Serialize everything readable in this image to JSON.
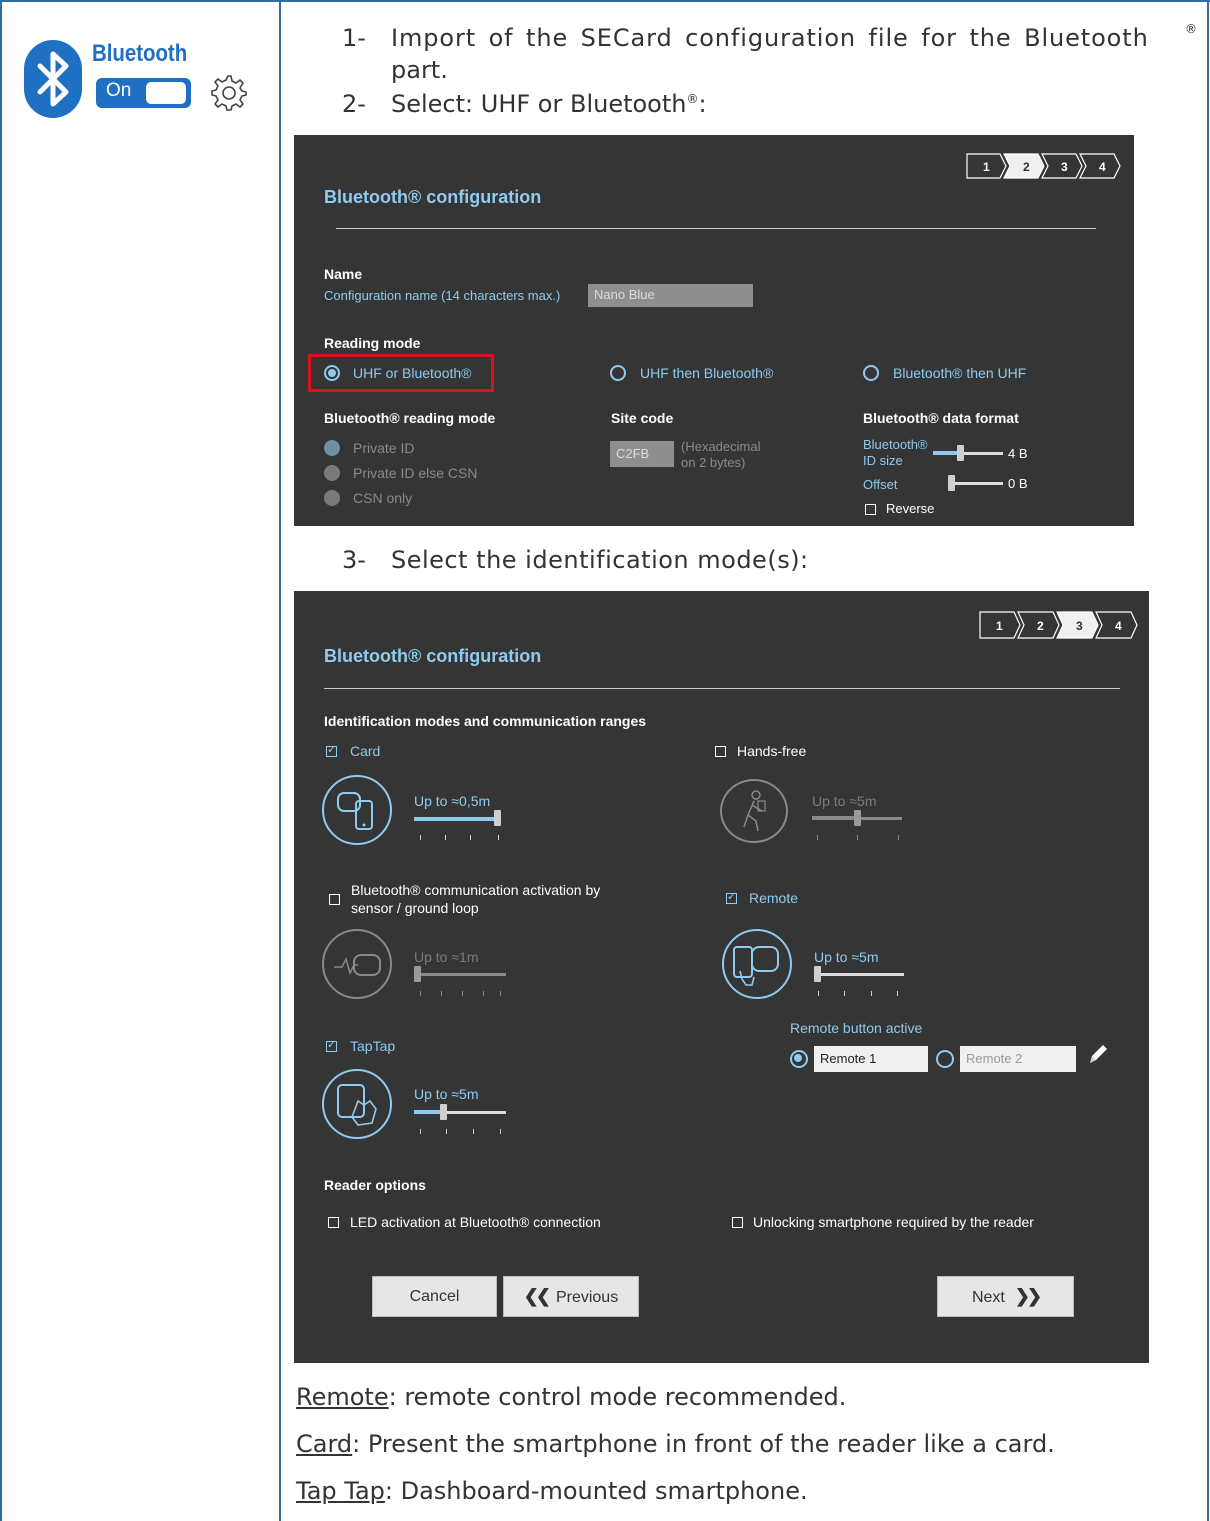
{
  "left_column": {
    "logo_text": "Bluetooth",
    "toggle_label": "On"
  },
  "steps_text": {
    "step1_num": "1-",
    "step1_line1": "Import of the SECard configuration file for the Bluetooth",
    "step1_sup": "®",
    "step1_line2": "part.",
    "step2_num": "2-",
    "step2_text": "Select: UHF or Bluetooth",
    "step2_sup": "®",
    "step2_colon": ":",
    "step3_num": "3-",
    "step3_text": "Select the identification mode(s):"
  },
  "panel1": {
    "title": "Bluetooth® configuration",
    "steps": [
      "1",
      "2",
      "3",
      "4"
    ],
    "active_step": "2",
    "name_label": "Name",
    "config_name_label": "Configuration name (14 characters max.)",
    "config_name_value": "Nano Blue",
    "reading_mode_label": "Reading mode",
    "mode_options": [
      "UHF or Bluetooth®",
      "UHF then Bluetooth®",
      "Bluetooth® then UHF"
    ],
    "selected_mode": "UHF or Bluetooth®",
    "bt_reading_mode_label": "Bluetooth® reading mode",
    "bt_reading_options": [
      "Private ID",
      "Private ID else CSN",
      "CSN only"
    ],
    "site_code_label": "Site code",
    "site_code_value": "C2FB",
    "site_code_hint_1": "(Hexadecimal",
    "site_code_hint_2": "on 2 bytes)",
    "data_format_label": "Bluetooth® data format",
    "id_size_label_1": "Bluetooth®",
    "id_size_label_2": "ID size",
    "id_size_value": "4 B",
    "offset_label": "Offset",
    "offset_value": "0 B",
    "reverse_label": "Reverse"
  },
  "panel2": {
    "title": "Bluetooth® configuration",
    "steps": [
      "1",
      "2",
      "3",
      "4"
    ],
    "active_step": "3",
    "section_label": "Identification modes and communication ranges",
    "card_label": "Card",
    "card_range": "Up to ≈0,5m",
    "handsfree_label": "Hands-free",
    "handsfree_range": "Up to ≈5m",
    "sensor_label_1": "Bluetooth® communication activation by",
    "sensor_label_2": "sensor / ground loop",
    "sensor_range": "Up to ≈1m",
    "remote_label": "Remote",
    "remote_range": "Up to ≈5m",
    "taptap_label": "TapTap",
    "taptap_range": "Up to ≈5m",
    "remote_button_label": "Remote button active",
    "remote1": "Remote 1",
    "remote2": "Remote 2",
    "reader_options_label": "Reader options",
    "led_option": "LED activation at Bluetooth® connection",
    "unlock_option": "Unlocking smartphone required by the reader",
    "cancel_label": "Cancel",
    "previous_label": "Previous",
    "next_label": "Next",
    "slider_levels": {
      "card": 1.0,
      "handsfree": 0.5,
      "sensor": 0.0,
      "remote": 0.0,
      "taptap": 0.33
    }
  },
  "notes": [
    {
      "term": "Remote",
      "text": ": remote control mode recommended."
    },
    {
      "term": "Card",
      "text": ": Present the smartphone in front of the reader like a card."
    },
    {
      "term": "Tap Tap",
      "text": ": Dashboard-mounted smartphone."
    }
  ],
  "colors": {
    "accent": "#8fcbf0",
    "panel_bg": "#353535",
    "frame": "#2e6da4",
    "highlight": "#e0101a",
    "bt_blue": "#1f6fc3"
  }
}
